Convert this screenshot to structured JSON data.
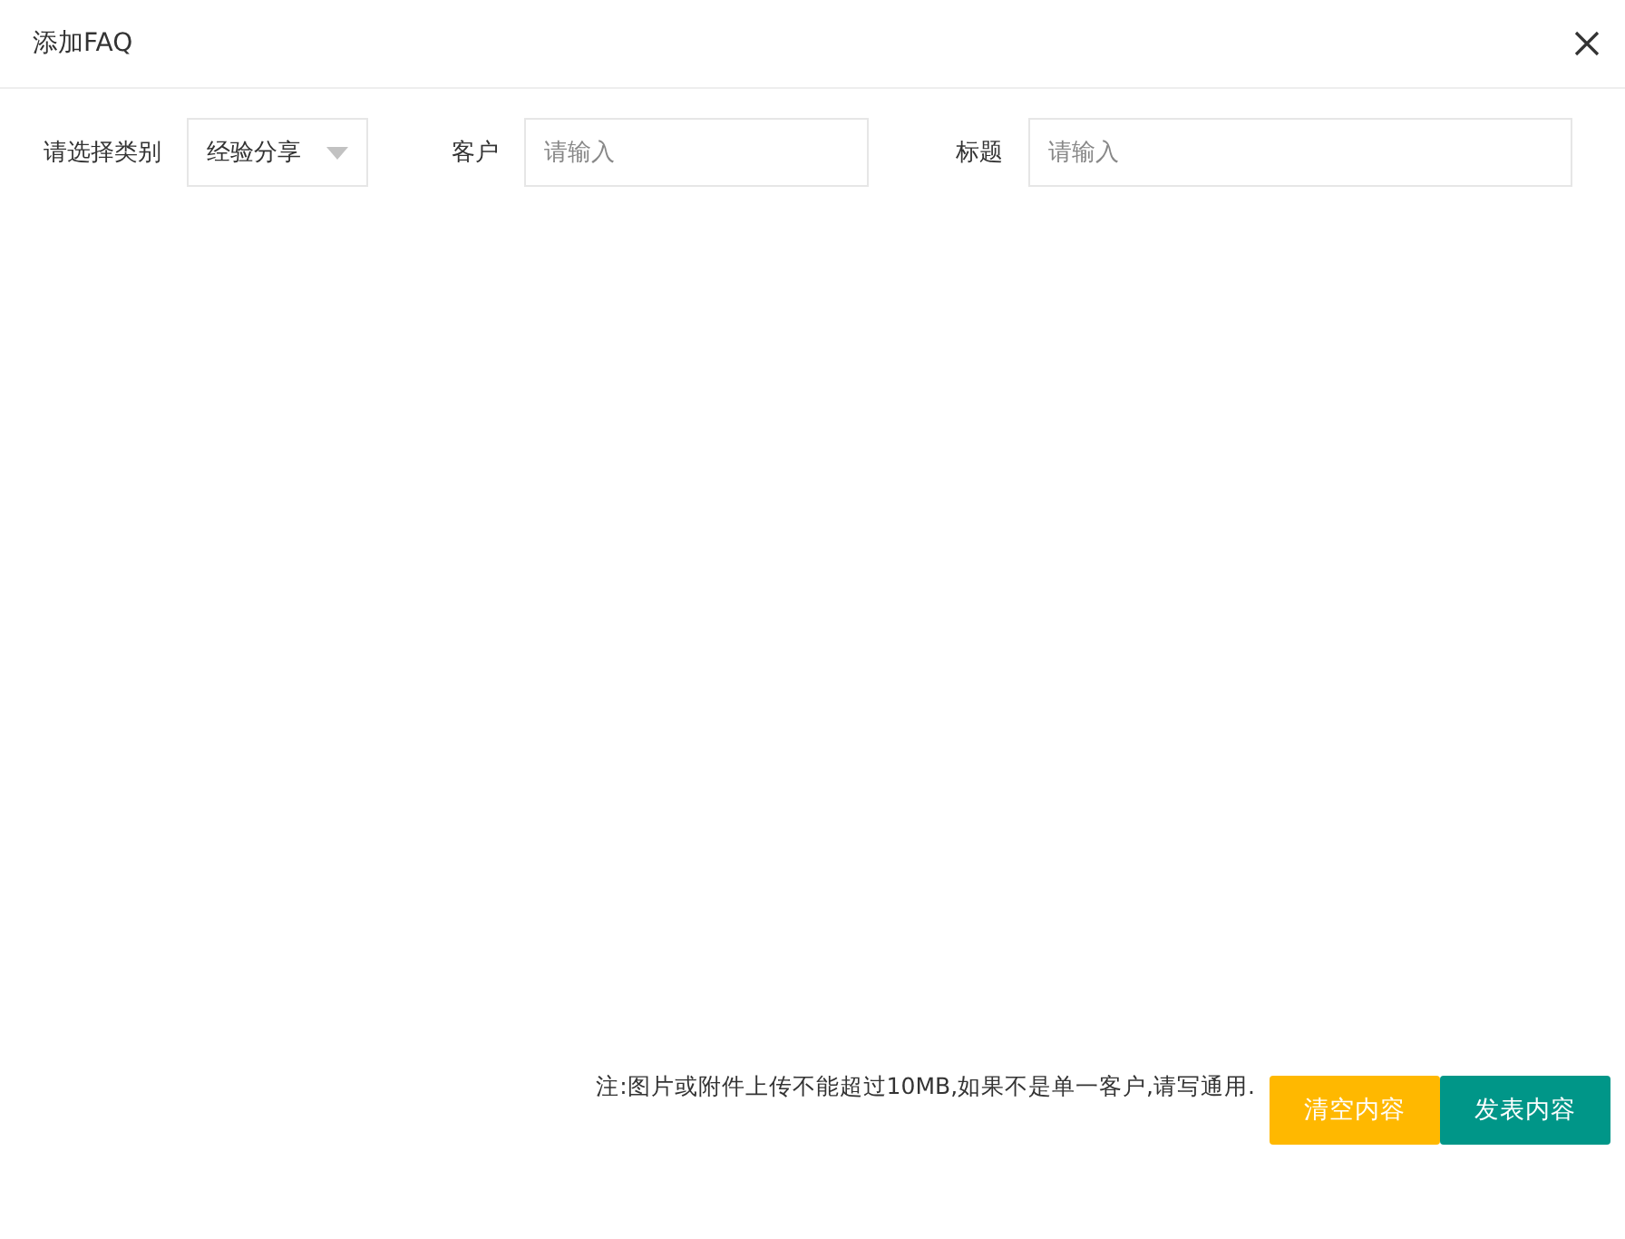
{
  "window": {
    "title": "添加FAQ"
  },
  "form": {
    "category": {
      "label": "请选择类别",
      "value": "经验分享"
    },
    "fields": [
      {
        "label": "客户",
        "placeholder": "请输入"
      },
      {
        "label": "标题",
        "placeholder": "请输入"
      }
    ]
  },
  "note": "注:图片或附件上传不能超过10MB,如果不是单一客户,请写通用.",
  "buttons": [
    {
      "label": "清空内容",
      "kind": "warning"
    },
    {
      "label": "发表内容",
      "kind": "primary"
    }
  ]
}
